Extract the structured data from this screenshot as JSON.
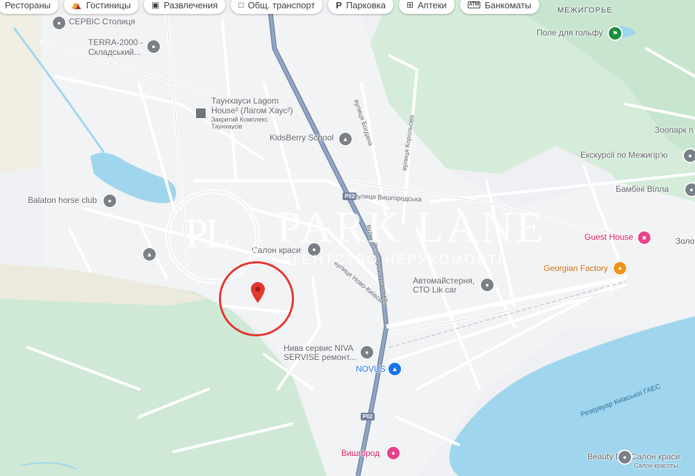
{
  "filter_chips": [
    {
      "label": "Рестораны",
      "icon": "fork-knife-icon"
    },
    {
      "label": "Гостиницы",
      "icon": "bed-icon"
    },
    {
      "label": "Развлечения",
      "icon": "camera-icon"
    },
    {
      "label": "Общ. транспорт",
      "icon": "bus-icon"
    },
    {
      "label": "Парковка",
      "icon": "parking-icon"
    },
    {
      "label": "Аптеки",
      "icon": "pharmacy-icon"
    },
    {
      "label": "Банкоматы",
      "icon": "atm-icon"
    }
  ],
  "areas": {
    "mezhyhirya": "МЕЖИГОРЬЕ"
  },
  "pois": {
    "servis_stolytsia": "СЕРВІС Столиця",
    "terra_line1": "TERRA-2000 -",
    "terra_line2": "Складський...",
    "townhouse_line1": "Таунхауси Lagom",
    "townhouse_line2": "House² (Лагом Хаус²)",
    "townhouse_sub1": "Закритий Комплекс",
    "townhouse_sub2": "Таунхаусів",
    "kidsberry": "KidsBerry School",
    "balaton": "Balaton horse club",
    "salon_krasy": "Салон краси",
    "avto_line1": "Автомайстерня,",
    "avto_line2": "СТО Lik car",
    "niva_line1": "Нива сервис NIVA",
    "niva_line2": "SERVISE ремонт...",
    "novus": "NOVUS",
    "vyshhorod": "Вишгород",
    "golf": "Поле для гольфу",
    "zoo": "Зоопарк п",
    "excursions": "Екскурсії по Межигір'ю",
    "bambini": "Бамбіні Вілла",
    "guest_house": "Guest House",
    "zolo": "Золо",
    "georgian": "Georgian Factory",
    "beauty_bar": "Beauty Bar Салон краси",
    "salon_krasoty": "Салон красоты"
  },
  "streets": {
    "bohdana": "вулиця Богдана",
    "korolova": "вулиця Корольова",
    "vyshhorodska": "вулиця Вишгородська",
    "svyato_pokrovska": "вулиця Свято-Покровська",
    "novo_kyivska": "вулиця Ново-Київська",
    "reservoir": "Резервуар Київської ГАЕС"
  },
  "road_shields": [
    "P02",
    "P02"
  ],
  "watermark": {
    "monogram": "PL",
    "title": "PARK LANE",
    "subtitle": "АГЕНТСТВО НЕРУХОМОСТІ"
  },
  "colors": {
    "land": "#eef0f3",
    "green": "#cfe9d6",
    "water": "#9fd6ee",
    "highway": "#8ea2bd",
    "marker": "#e3362d"
  }
}
